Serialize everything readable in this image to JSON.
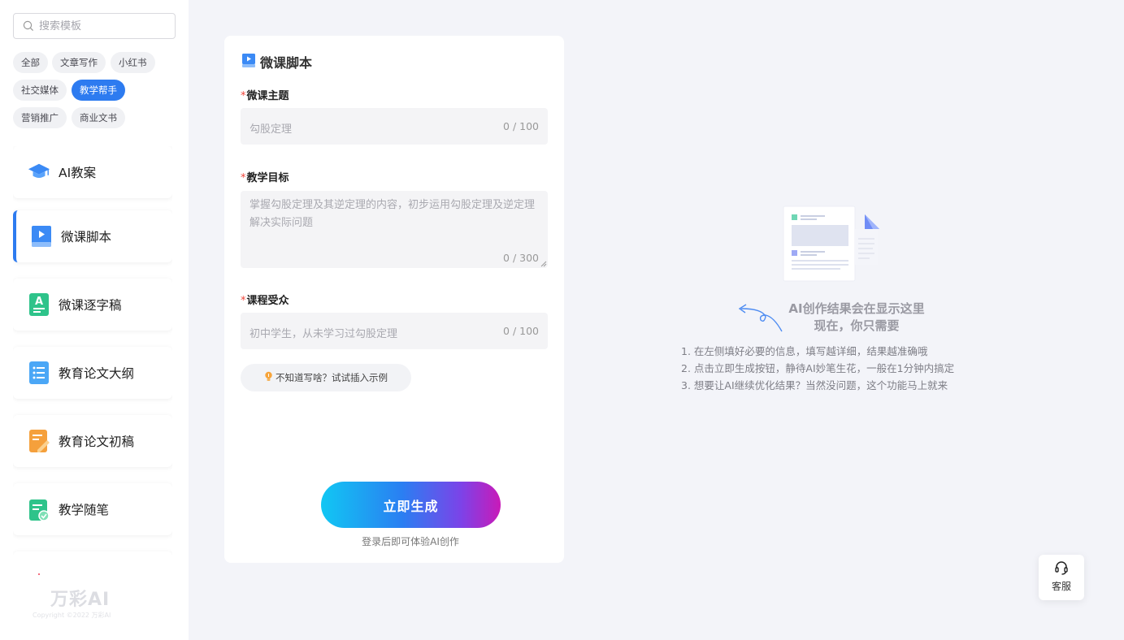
{
  "search": {
    "placeholder": "搜索模板"
  },
  "categories": [
    {
      "label": "全部",
      "active": false
    },
    {
      "label": "文章写作",
      "active": false
    },
    {
      "label": "小红书",
      "active": false
    },
    {
      "label": "社交媒体",
      "active": false
    },
    {
      "label": "教学帮手",
      "active": true
    },
    {
      "label": "营销推广",
      "active": false
    },
    {
      "label": "商业文书",
      "active": false
    }
  ],
  "templates": [
    {
      "label": "AI教案",
      "icon": "graduation-cap-icon",
      "active": false
    },
    {
      "label": "微课脚本",
      "icon": "video-book-icon",
      "active": true
    },
    {
      "label": "微课逐字稿",
      "icon": "document-a-icon",
      "active": false
    },
    {
      "label": "教育论文大纲",
      "icon": "list-document-icon",
      "active": false
    },
    {
      "label": "教育论文初稿",
      "icon": "draft-pen-icon",
      "active": false
    },
    {
      "label": "教学随笔",
      "icon": "calendar-check-icon",
      "active": false
    }
  ],
  "brand": {
    "logo": "万彩AI",
    "copyright": "Copyright ©2022 万彩AI"
  },
  "form": {
    "title": "微课脚本",
    "fields": [
      {
        "label": "微课主题",
        "placeholder": "勾股定理",
        "counter": "0 / 100"
      },
      {
        "label": "教学目标",
        "placeholder": "掌握勾股定理及其逆定理的内容，初步运用勾股定理及逆定理解决实际问题",
        "counter": "0 / 300"
      },
      {
        "label": "课程受众",
        "placeholder": "初中学生，从未学习过勾股定理",
        "counter": "0 / 100"
      }
    ],
    "hint": "不知道写啥？试试插入示例",
    "generate": "立即生成",
    "login_tip": "登录后即可体验AI创作"
  },
  "result": {
    "title_line1": "AI创作结果会在显示这里",
    "title_line2": "现在，你只需要",
    "steps": [
      "1. 在左侧填好必要的信息，填写越详细，结果越准确哦",
      "2. 点击立即生成按钮，静待AI妙笔生花，一般在1分钟内搞定",
      "3. 想要让AI继续优化结果？当然没问题，这个功能马上就来"
    ]
  },
  "service": {
    "label": "客服"
  },
  "colors": {
    "accent": "#2d7bf0",
    "required": "#f0453a"
  }
}
